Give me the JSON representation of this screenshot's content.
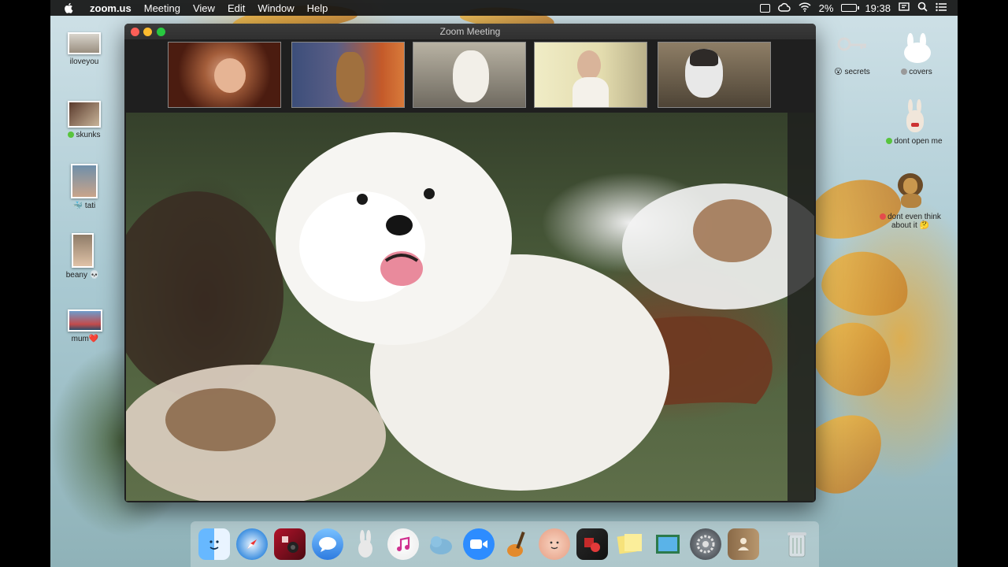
{
  "menubar": {
    "app_name": "zoom.us",
    "menus": [
      "Meeting",
      "View",
      "Edit",
      "Window",
      "Help"
    ],
    "battery": "2%",
    "time": "19:38"
  },
  "desktop_icons_left": [
    {
      "label": "iloveyou"
    },
    {
      "label": "skunks",
      "tag_color": "#58c43d"
    },
    {
      "label": "🐳 tati"
    },
    {
      "label": "beany 💀"
    },
    {
      "label": "mum❤️"
    }
  ],
  "desktop_icons_right": [
    {
      "label": "😮 secrets"
    },
    {
      "label": "covers",
      "tag_color": "#9a9a9a"
    },
    {
      "label": "dont open me",
      "tag_color": "#58c43d"
    },
    {
      "label": "dont even think about it 🤔",
      "tag_color": "#e44b4b"
    }
  ],
  "zoom": {
    "window_title": "Zoom Meeting",
    "participants": [
      {
        "subject": "person-laughing",
        "bg": "#6b2a1a"
      },
      {
        "subject": "dog-on-chair",
        "bg": "#40507a"
      },
      {
        "subject": "white-dog",
        "bg": "#8f8f84"
      },
      {
        "subject": "woman",
        "bg": "#e9e3b8"
      },
      {
        "subject": "husky",
        "bg": "#6a5c48"
      }
    ]
  },
  "dock": {
    "apps": [
      "Finder",
      "Safari",
      "Photo Booth",
      "Messages",
      "Rabbit",
      "iTunes",
      "Seal",
      "Zoom",
      "GarageBand",
      "Face",
      "Photo Booth 2",
      "Stickies",
      "Preview",
      "System Preferences",
      "Contacts"
    ],
    "trash": "Trash"
  }
}
